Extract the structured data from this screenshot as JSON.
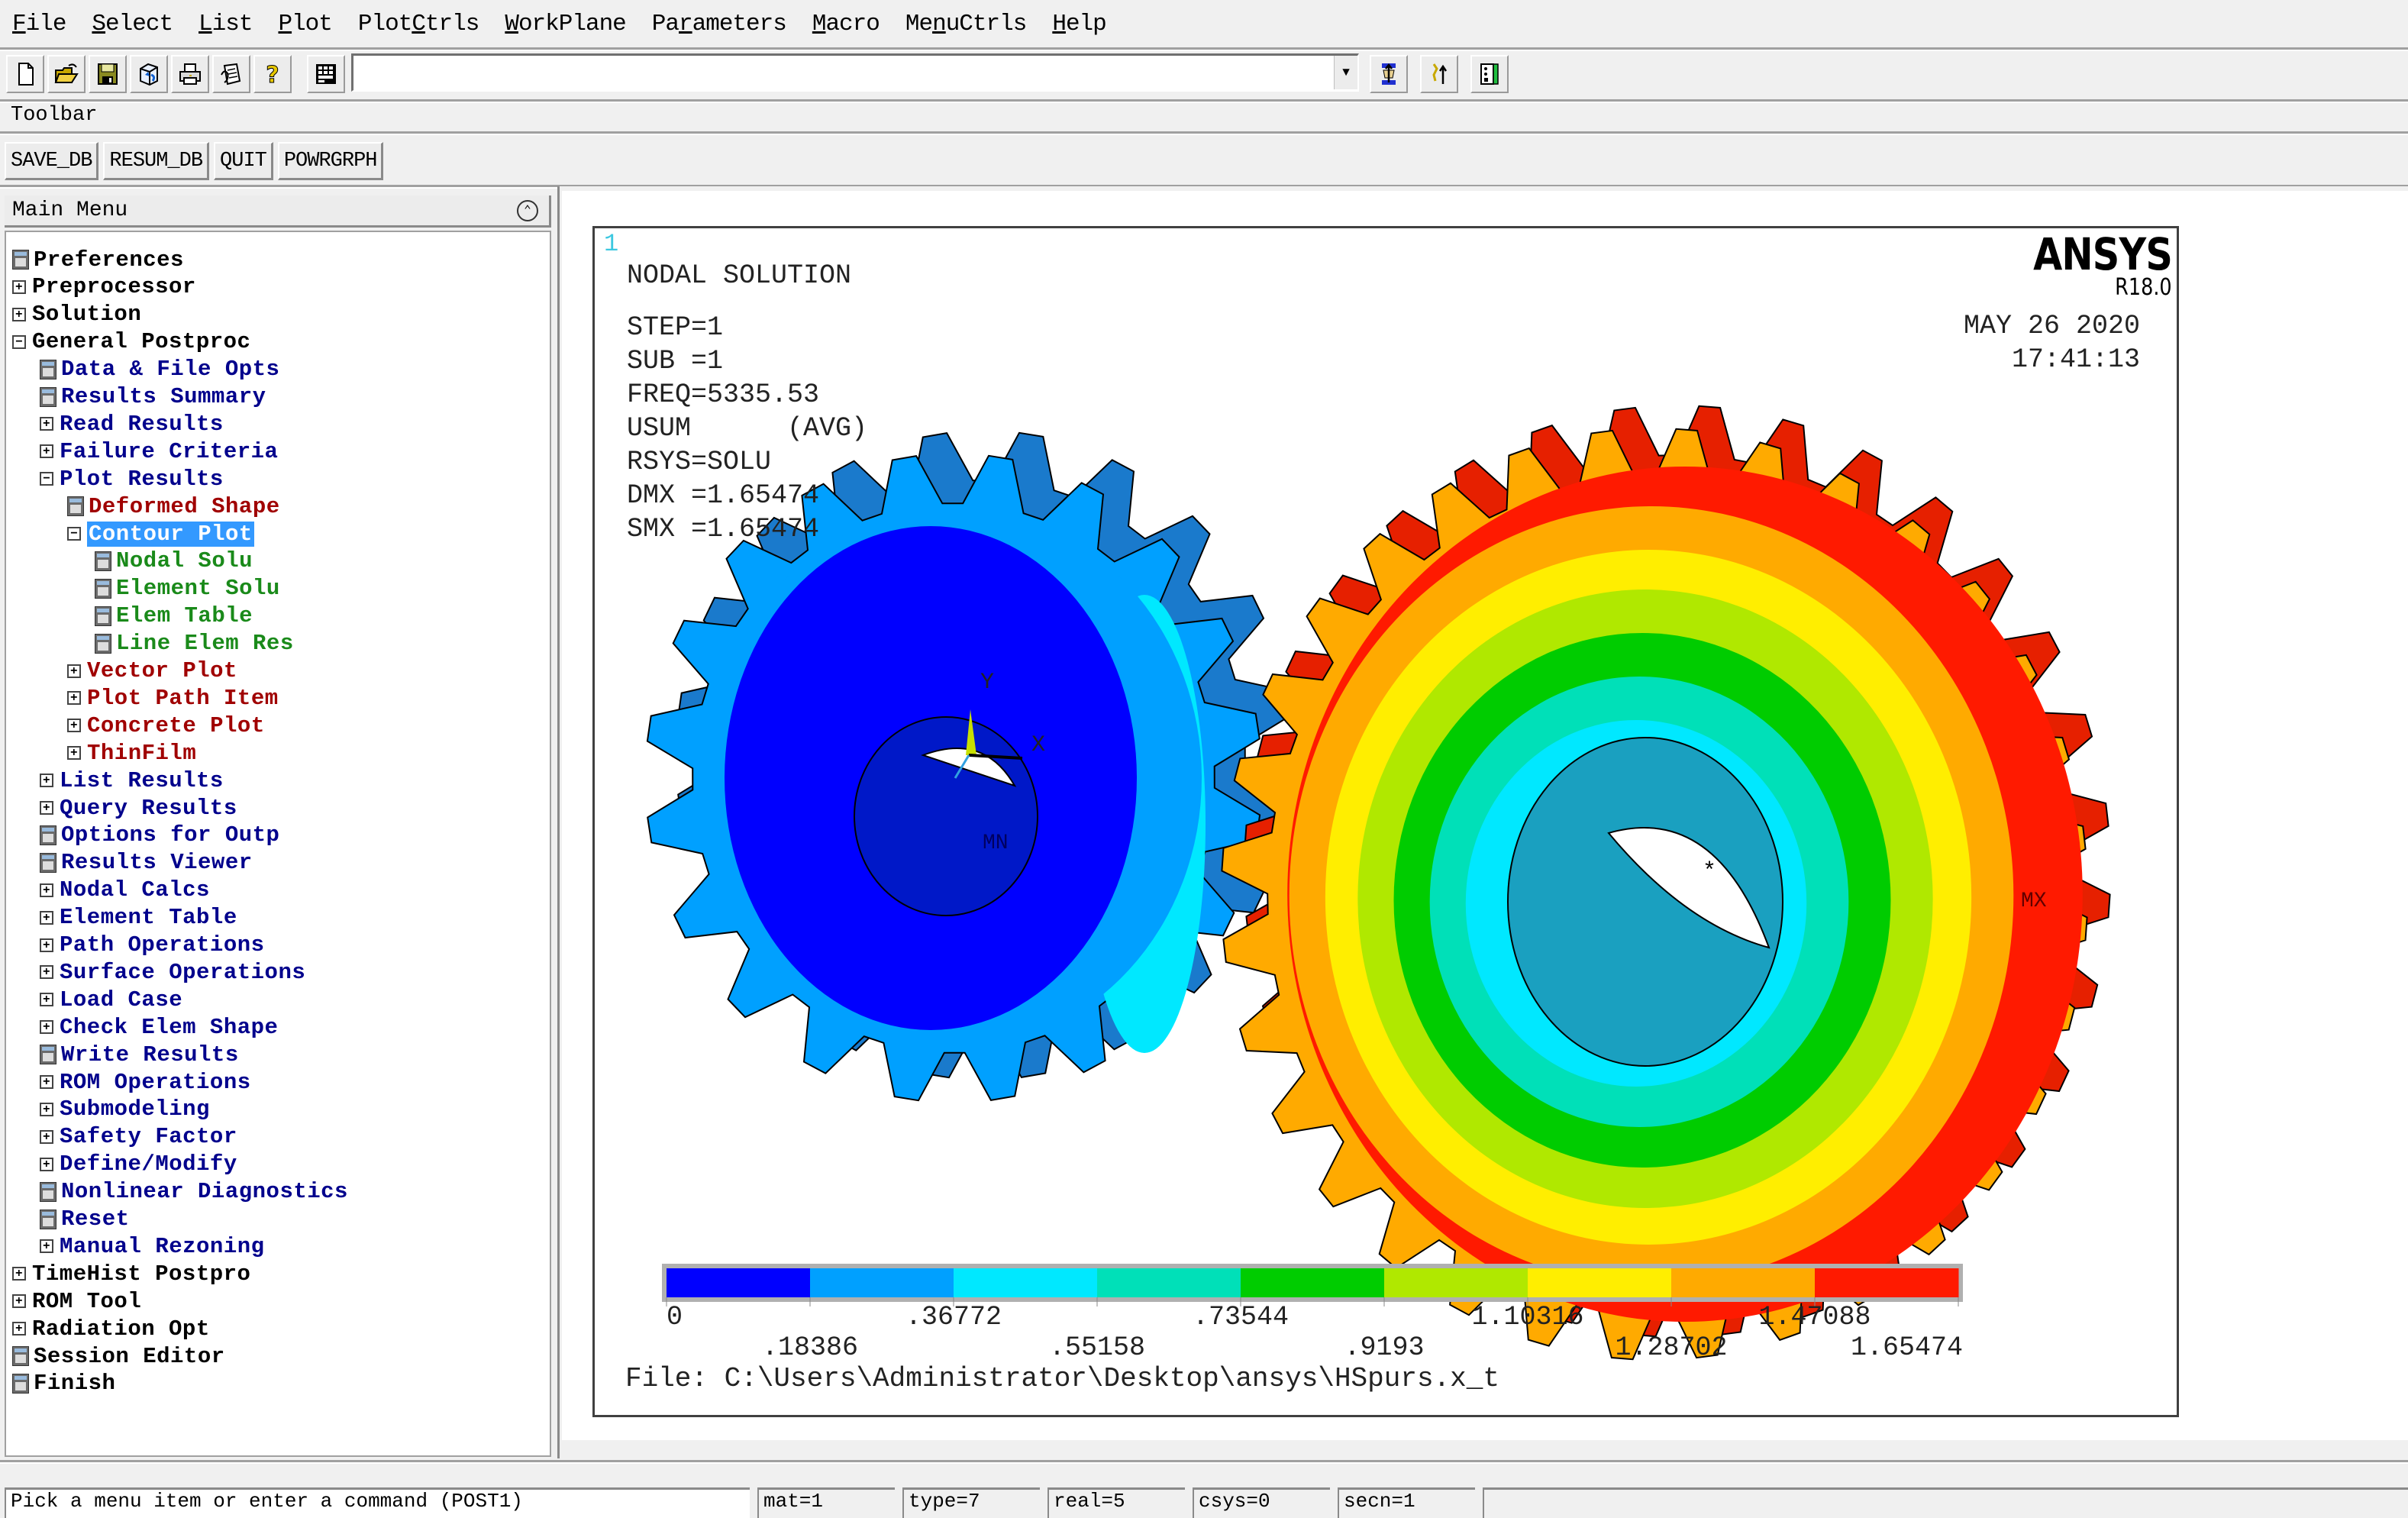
{
  "menubar": {
    "items": [
      {
        "label": "File",
        "mnemonic": "F"
      },
      {
        "label": "Select",
        "mnemonic": "S"
      },
      {
        "label": "List",
        "mnemonic": "L"
      },
      {
        "label": "Plot",
        "mnemonic": "P"
      },
      {
        "label": "PlotCtrls",
        "mnemonic": "C"
      },
      {
        "label": "WorkPlane",
        "mnemonic": "W"
      },
      {
        "label": "Parameters",
        "mnemonic": "r"
      },
      {
        "label": "Macro",
        "mnemonic": "M"
      },
      {
        "label": "MenuCtrls",
        "mnemonic": "n"
      },
      {
        "label": "Help",
        "mnemonic": "H"
      }
    ]
  },
  "icon_toolbar": {
    "left_icons": [
      "new-file-icon",
      "open-file-icon",
      "save-icon",
      "pan-zoom-rotate-icon",
      "print-icon",
      "report-generator-icon",
      "help-icon",
      "command-keyboard-icon"
    ],
    "command_input": {
      "value": "",
      "placeholder": ""
    },
    "right_icons": [
      "raise-hidden-icon",
      "reset-picking-icon",
      "contact-manager-icon"
    ]
  },
  "toolbar": {
    "label": "Toolbar",
    "buttons": [
      "SAVE_DB",
      "RESUM_DB",
      "QUIT",
      "POWRGRPH"
    ]
  },
  "main_menu": {
    "title": "Main Menu",
    "collapse_icon": "double-chevron-up-icon",
    "items": [
      {
        "label": "Preferences",
        "level": 0,
        "type": "dialog",
        "color": "black"
      },
      {
        "label": "Preprocessor",
        "level": 0,
        "type": "expand",
        "color": "black"
      },
      {
        "label": "Solution",
        "level": 0,
        "type": "expand",
        "color": "black"
      },
      {
        "label": "General Postproc",
        "level": 0,
        "type": "collapse",
        "color": "black"
      },
      {
        "label": "Data & File Opts",
        "level": 1,
        "type": "dialog",
        "color": "blue"
      },
      {
        "label": "Results Summary",
        "level": 1,
        "type": "dialog",
        "color": "blue"
      },
      {
        "label": "Read Results",
        "level": 1,
        "type": "expand",
        "color": "blue"
      },
      {
        "label": "Failure Criteria",
        "level": 1,
        "type": "expand",
        "color": "blue"
      },
      {
        "label": "Plot Results",
        "level": 1,
        "type": "collapse",
        "color": "blue"
      },
      {
        "label": "Deformed Shape",
        "level": 2,
        "type": "dialog",
        "color": "red"
      },
      {
        "label": "Contour Plot",
        "level": 2,
        "type": "collapse",
        "color": "red",
        "selected": true
      },
      {
        "label": "Nodal Solu",
        "level": 3,
        "type": "dialog",
        "color": "green"
      },
      {
        "label": "Element Solu",
        "level": 3,
        "type": "dialog",
        "color": "green"
      },
      {
        "label": "Elem Table",
        "level": 3,
        "type": "dialog",
        "color": "green"
      },
      {
        "label": "Line Elem Res",
        "level": 3,
        "type": "dialog",
        "color": "green"
      },
      {
        "label": "Vector Plot",
        "level": 2,
        "type": "expand",
        "color": "red"
      },
      {
        "label": "Plot Path Item",
        "level": 2,
        "type": "expand",
        "color": "red"
      },
      {
        "label": "Concrete Plot",
        "level": 2,
        "type": "expand",
        "color": "red"
      },
      {
        "label": "ThinFilm",
        "level": 2,
        "type": "expand",
        "color": "red"
      },
      {
        "label": "List Results",
        "level": 1,
        "type": "expand",
        "color": "blue"
      },
      {
        "label": "Query Results",
        "level": 1,
        "type": "expand",
        "color": "blue"
      },
      {
        "label": "Options for Outp",
        "level": 1,
        "type": "dialog",
        "color": "blue"
      },
      {
        "label": "Results Viewer",
        "level": 1,
        "type": "dialog",
        "color": "blue"
      },
      {
        "label": "Nodal Calcs",
        "level": 1,
        "type": "expand",
        "color": "blue"
      },
      {
        "label": "Element Table",
        "level": 1,
        "type": "expand",
        "color": "blue"
      },
      {
        "label": "Path Operations",
        "level": 1,
        "type": "expand",
        "color": "blue"
      },
      {
        "label": "Surface Operations",
        "level": 1,
        "type": "expand",
        "color": "blue"
      },
      {
        "label": "Load Case",
        "level": 1,
        "type": "expand",
        "color": "blue"
      },
      {
        "label": "Check Elem Shape",
        "level": 1,
        "type": "expand",
        "color": "blue"
      },
      {
        "label": "Write Results",
        "level": 1,
        "type": "dialog",
        "color": "blue"
      },
      {
        "label": "ROM Operations",
        "level": 1,
        "type": "expand",
        "color": "blue"
      },
      {
        "label": "Submodeling",
        "level": 1,
        "type": "expand",
        "color": "blue"
      },
      {
        "label": "Safety Factor",
        "level": 1,
        "type": "expand",
        "color": "blue"
      },
      {
        "label": "Define/Modify",
        "level": 1,
        "type": "expand",
        "color": "blue"
      },
      {
        "label": "Nonlinear Diagnostics",
        "level": 1,
        "type": "dialog",
        "color": "blue"
      },
      {
        "label": "Reset",
        "level": 1,
        "type": "dialog",
        "color": "blue"
      },
      {
        "label": "Manual Rezoning",
        "level": 1,
        "type": "expand",
        "color": "blue"
      },
      {
        "label": "TimeHist Postpro",
        "level": 0,
        "type": "expand",
        "color": "black"
      },
      {
        "label": "ROM Tool",
        "level": 0,
        "type": "expand",
        "color": "black"
      },
      {
        "label": "Radiation Opt",
        "level": 0,
        "type": "expand",
        "color": "black"
      },
      {
        "label": "Session Editor",
        "level": 0,
        "type": "dialog",
        "color": "black"
      },
      {
        "label": "Finish",
        "level": 0,
        "type": "dialog",
        "color": "black"
      }
    ]
  },
  "graphics": {
    "window_number": "1",
    "brand": "ANSYS",
    "version": "R18.0",
    "date": "MAY 26 2020",
    "time": "17:41:13",
    "info_lines": [
      "NODAL SOLUTION",
      "STEP=1",
      "SUB =1",
      "FREQ=5335.53",
      "USUM      (AVG)",
      "RSYS=SOLU",
      "DMX =1.65474",
      "SMX =1.65474"
    ],
    "triad": {
      "y_label": "Y",
      "x_label": "X"
    },
    "min_marker": "MN",
    "max_marker": "MX",
    "file_line": "File: C:\\Users\\Administrator\\Desktop\\ansys\\HSpurs.x_t",
    "legend": {
      "values": [
        "0",
        ".18386",
        ".36772",
        ".55158",
        ".73544",
        ".9193",
        "1.10316",
        "1.28702",
        "1.47088",
        "1.65474"
      ],
      "colors": [
        "#0000ff",
        "#00a0ff",
        "#00e8ff",
        "#00e0b8",
        "#00cc00",
        "#b0e800",
        "#ffee00",
        "#ffaa00",
        "#ff1a00"
      ]
    }
  },
  "status_bar": {
    "message": "Pick a menu item or enter a command (POST1)",
    "fields": [
      "mat=1",
      "type=7",
      "real=5",
      "csys=0",
      "secn=1"
    ]
  }
}
